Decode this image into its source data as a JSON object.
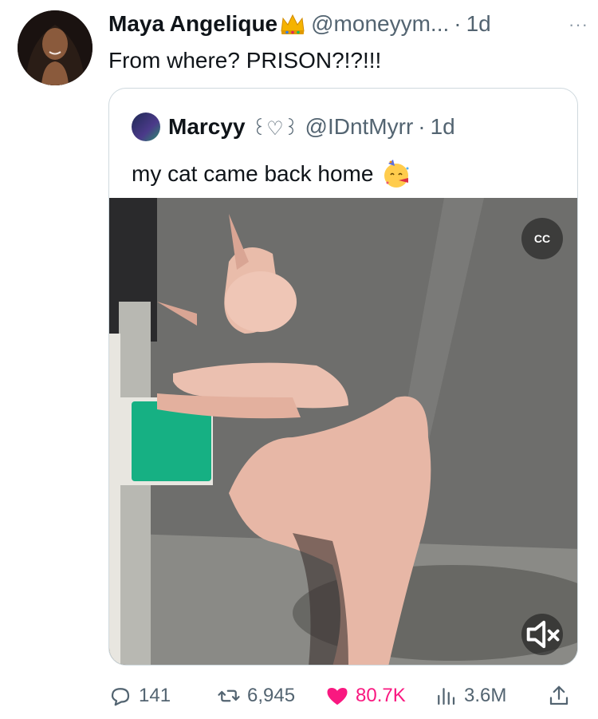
{
  "tweet": {
    "author_name": "Maya Angelique",
    "author_handle": "@moneyym...",
    "separator": "·",
    "time": "1d",
    "text": "From where? PRISON?!?!!!",
    "more_label": "···"
  },
  "quote": {
    "author_name": "Marcyy",
    "author_decoration": "꒰♡꒱",
    "author_handle": "@IDntMyrr",
    "separator": "·",
    "time": "1d",
    "text": "my cat came back home",
    "emoji": "partying-face-emoji"
  },
  "media": {
    "cc_label": "CC",
    "mute_icon": "speaker-muted-icon"
  },
  "actions": {
    "replies": "141",
    "reposts": "6,945",
    "likes": "80.7K",
    "views": "3.6M"
  },
  "colors": {
    "text": "#0f1419",
    "secondary": "#536471",
    "like": "#f91880",
    "border": "#cfd9de"
  }
}
